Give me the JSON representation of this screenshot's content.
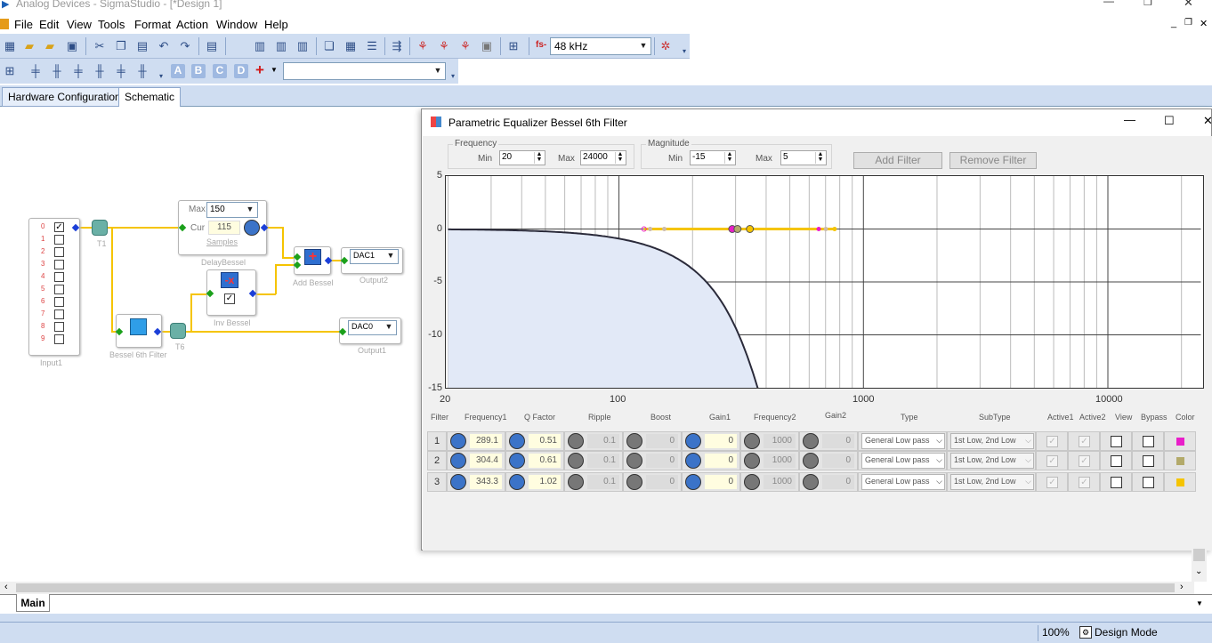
{
  "app": {
    "title": "Analog Devices - SigmaStudio - [*Design 1]"
  },
  "menu": [
    "File",
    "Edit",
    "View",
    "Tools",
    "Format",
    "Action",
    "Window",
    "Help"
  ],
  "toolbar": {
    "sample_rate_prefix": "fs-",
    "sample_rate": "48 kHz",
    "block_buttons": [
      "A",
      "B",
      "C",
      "D"
    ],
    "add_button": "+",
    "combo_value": ""
  },
  "tabs": [
    "Hardware Configuration",
    "Schematic"
  ],
  "schematic": {
    "input": {
      "label": "Input1",
      "channels": [
        "0",
        "1",
        "2",
        "3",
        "4",
        "5",
        "6",
        "7",
        "8",
        "9"
      ]
    },
    "t1": "T1",
    "t6": "T6",
    "delay": {
      "max_label": "Max",
      "max_value": "150",
      "cur_label": "Cur",
      "cur_value": "115",
      "samples_label": "Samples",
      "name": "DelayBessel"
    },
    "inv": {
      "name": "Inv Bessel"
    },
    "add": {
      "name": "Add Bessel"
    },
    "bessel": {
      "name": "Bessel 6th Filter"
    },
    "out2": {
      "dac": "DAC1",
      "name": "Output2"
    },
    "out1": {
      "dac": "DAC0",
      "name": "Output1"
    }
  },
  "eq": {
    "title": "Parametric Equalizer Bessel 6th Filter",
    "frequency_group": "Frequency",
    "magnitude_group": "Magnitude",
    "min_label": "Min",
    "max_label": "Max",
    "freq_min": "20",
    "freq_max": "24000",
    "mag_min": "-15",
    "mag_max": "5",
    "add_filter": "Add Filter",
    "remove_filter": "Remove Filter",
    "y_ticks": [
      "5",
      "0",
      "-5",
      "-10",
      "-15"
    ],
    "x_ticks": [
      "20",
      "100",
      "1000",
      "10000"
    ],
    "table_headers": [
      "Filter",
      "Frequency1",
      "Q Factor",
      "Ripple",
      "Boost",
      "Gain1",
      "Frequency2",
      "Gain2",
      "Type",
      "SubType",
      "Active1",
      "Active2",
      "View",
      "Bypass",
      "Color"
    ],
    "rows": [
      {
        "filter": "1",
        "frequency1": "289.1",
        "q": "0.51",
        "ripple": "0.1",
        "boost": "0",
        "gain1": "0",
        "frequency2": "1000",
        "gain2": "0",
        "type": "General Low pass",
        "subtype": "1st Low, 2nd Low",
        "color": "#e91ec9"
      },
      {
        "filter": "2",
        "frequency1": "304.4",
        "q": "0.61",
        "ripple": "0.1",
        "boost": "0",
        "gain1": "0",
        "frequency2": "1000",
        "gain2": "0",
        "type": "General Low pass",
        "subtype": "1st Low, 2nd Low",
        "color": "#b3aa6a"
      },
      {
        "filter": "3",
        "frequency1": "343.3",
        "q": "1.02",
        "ripple": "0.1",
        "boost": "0",
        "gain1": "0",
        "frequency2": "1000",
        "gain2": "0",
        "type": "General Low pass",
        "subtype": "1st Low, 2nd Low",
        "color": "#f5c400"
      }
    ]
  },
  "bottom": {
    "main_tab": "Main",
    "zoom": "100%",
    "mode": "Design Mode"
  }
}
